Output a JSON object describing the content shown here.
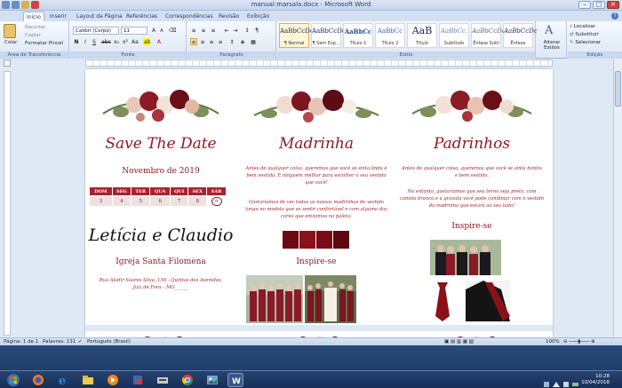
{
  "window": {
    "title": "manual marsala.docx - Microsoft Word",
    "minimize": "–",
    "maximize": "□",
    "close": "✕"
  },
  "tabs": [
    "Início",
    "Inserir",
    "Layout da Página",
    "Referências",
    "Correspondências",
    "Revisão",
    "Exibição"
  ],
  "ribbon": {
    "clipboard": {
      "label": "Área de Transferência",
      "paste": "Colar",
      "cut": "Recortar",
      "copy": "Copiar",
      "format_painter": "Formatar Pincel"
    },
    "font": {
      "label": "Fonte",
      "font_name": "Calibri (Corpo)",
      "font_size": "11"
    },
    "paragraph": {
      "label": "Parágrafo"
    },
    "styles": {
      "label": "Estilo",
      "items": [
        {
          "sample": "AaBbCcDc",
          "name": "¶ Normal"
        },
        {
          "sample": "AaBbCcDc",
          "name": "¶ Sem Esp..."
        },
        {
          "sample": "AaBbCc",
          "name": "Título 1"
        },
        {
          "sample": "AaBbCc",
          "name": "Título 2"
        },
        {
          "sample": "AaB",
          "name": "Título"
        },
        {
          "sample": "AaBbCc.",
          "name": "Subtítulo"
        },
        {
          "sample": "AaBbCcDc",
          "name": "Ênfase Sutil"
        },
        {
          "sample": "AaBbCcDc",
          "name": "Ênfase"
        }
      ],
      "change_styles": "Alterar Estilos"
    },
    "editing": {
      "label": "Edição",
      "find": "Localizar",
      "replace": "Substituir",
      "select": "Selecionar"
    }
  },
  "document": {
    "col1": {
      "heading": "Save The Date",
      "month": "Novembro de 2019",
      "calendar_headers": [
        "DOM",
        "SEG",
        "TER",
        "QUA",
        "QUI",
        "SEX",
        "SÁB"
      ],
      "calendar_days": [
        "3",
        "4",
        "5",
        "6",
        "7",
        "8",
        "9"
      ],
      "couple": "Letícia e Claudio",
      "church": "Igreja Santa Filomena",
      "address_line1": "Rua Aladir Soares Silva, 156 - Quintas das Avenidas,",
      "address_line2": "Juiz de Fora – MG______"
    },
    "col2": {
      "heading": "Madrinha",
      "para1": "Antes de qualquer coisa, queremos que você se sinta linda e bem vestida. E ninguém melhor para escolher o seu vestido que você!",
      "para2": "Gostaríamos de ver todas as nossas madrinhas de vestido longo no modelo que se sentir confortável e com alguma das cores que enviamos na paleta:",
      "inspire": "Inspire-se",
      "swatches": [
        "#6b0a12",
        "#8a1019",
        "#7a0c16",
        "#5e0810"
      ]
    },
    "col3": {
      "heading": "Padrinhos",
      "para1": "Antes de qualquer coisa, queremos que você se sinta bonito e bem vestido.",
      "para2": "No entanto, gostaríamos que seu terno seja preto, com camisa branca e a gravata você pode combinar com o vestido da madrinha que estará ao seu lado!",
      "inspire": "Inspire-se"
    }
  },
  "status": {
    "page": "Página: 1 de 1",
    "words": "Palavras: 131",
    "language": "Português (Brasil)",
    "zoom": "100%"
  },
  "clock": {
    "time": "10:28",
    "date": "10/04/2018"
  }
}
